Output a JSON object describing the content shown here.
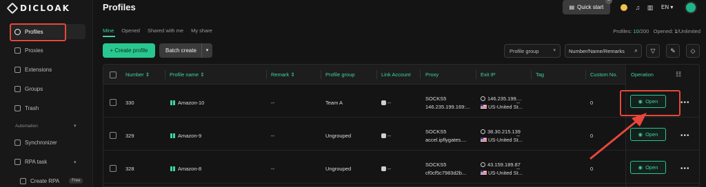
{
  "app": {
    "logo_text": "DICLOAK"
  },
  "sidebar": {
    "items": [
      {
        "label": "Profiles",
        "icon": "profiles-icon",
        "active": true
      },
      {
        "label": "Proxies",
        "icon": "proxies-icon"
      },
      {
        "label": "Extensions",
        "icon": "extensions-icon"
      },
      {
        "label": "Groups",
        "icon": "groups-icon"
      },
      {
        "label": "Trash",
        "icon": "trash-icon"
      }
    ],
    "section_label": "Automation",
    "automation_items": [
      {
        "label": "Synchronizer",
        "icon": "sync-icon"
      },
      {
        "label": "RPA task",
        "icon": "rpa-icon"
      },
      {
        "label": "Create RPA",
        "icon": "create-rpa-icon",
        "badge": "Free"
      }
    ]
  },
  "header": {
    "title": "Profiles",
    "quick_start": "Quick start",
    "language": "EN"
  },
  "tabs": [
    "Mine",
    "Opened",
    "Shared with me",
    "My share"
  ],
  "stats": {
    "profiles_label": "Profiles:",
    "profiles_value": "10",
    "profiles_total": "/200",
    "opened_label": "Opened:",
    "opened_value": "1",
    "opened_total": "/Unlimited"
  },
  "toolbar": {
    "create_label": "+ Create profile",
    "batch_label": "Batch create",
    "group_select": "Profile group",
    "search_placeholder": "Number/Name/Remarks"
  },
  "table": {
    "columns": [
      "Number",
      "Profile name",
      "Remark",
      "Profile group",
      "Link Account",
      "Proxy",
      "Exit IP",
      "Tag",
      "Custom No.",
      "Operation"
    ],
    "rows": [
      {
        "number": "330",
        "name": "Amazon-10",
        "remark": "--",
        "group": "Team A",
        "link": "--",
        "proxy_type": "SOCKS5",
        "proxy_host": "146.235.199.169:...",
        "exit_ip": "146.235.199....",
        "country": "US-United St...",
        "tag": "--",
        "custom": "0",
        "open_label": "Open"
      },
      {
        "number": "329",
        "name": "Amazon-9",
        "remark": "--",
        "group": "Ungrouped",
        "link": "--",
        "proxy_type": "SOCKS5",
        "proxy_host": "accel.ipflygates....",
        "exit_ip": "38.30.215.139",
        "country": "US-United St...",
        "tag": "--",
        "custom": "0",
        "open_label": "Open"
      },
      {
        "number": "328",
        "name": "Amazon-8",
        "remark": "--",
        "group": "Ungrouped",
        "link": "--",
        "proxy_type": "SOCKS5",
        "proxy_host": "cf0cf5c7983d2b...",
        "exit_ip": "43.159.189.87",
        "country": "US-United St...",
        "tag": "--",
        "custom": "0",
        "open_label": "Open"
      }
    ]
  },
  "colors": {
    "accent": "#3fd3a2",
    "highlight": "#e8473c",
    "background": "#141414"
  }
}
